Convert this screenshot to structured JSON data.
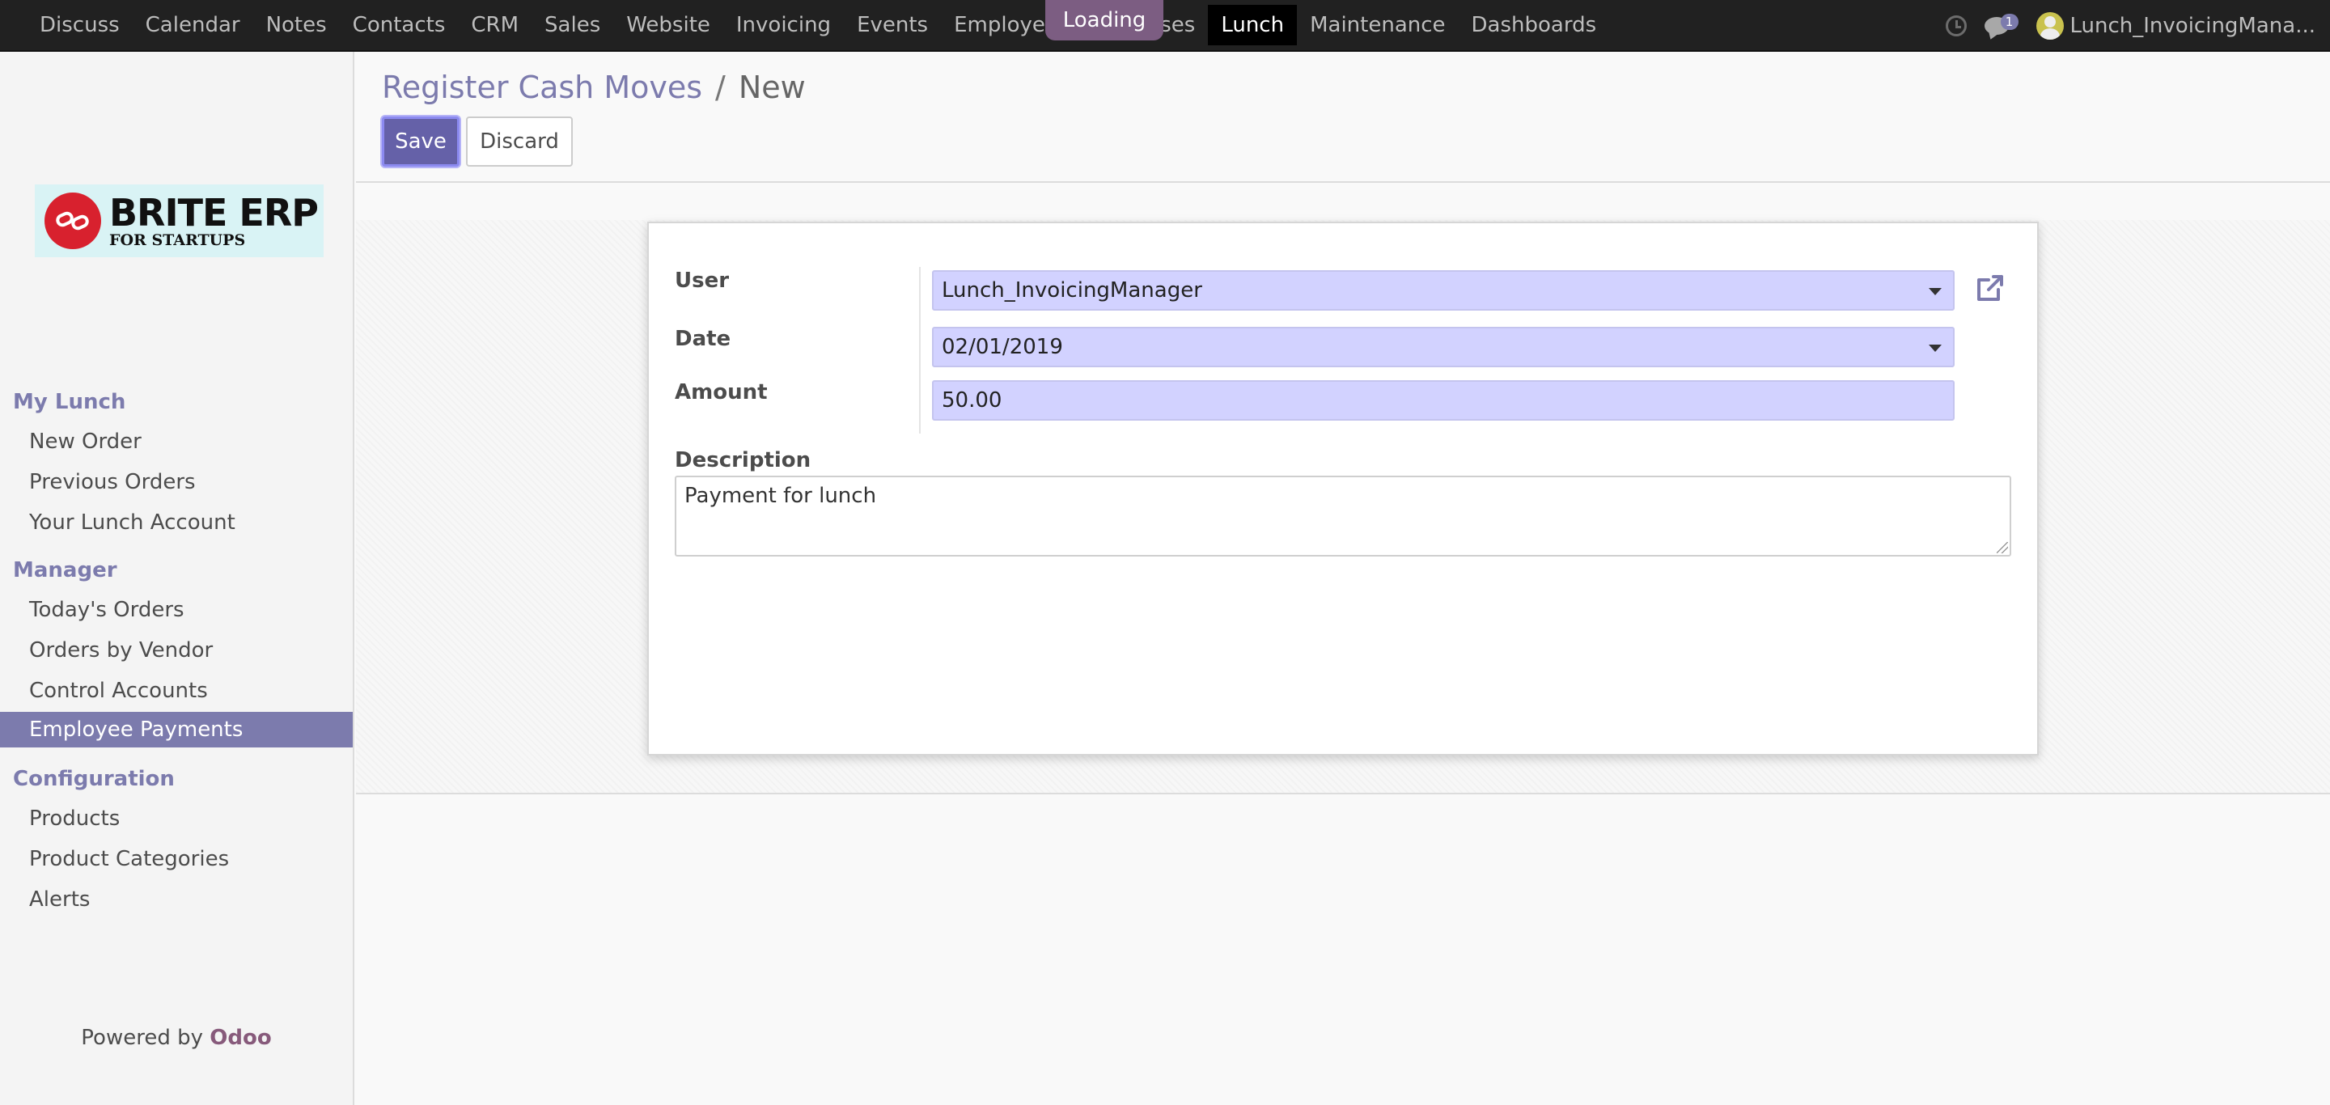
{
  "topnav": {
    "items": [
      "Discuss",
      "Calendar",
      "Notes",
      "Contacts",
      "CRM",
      "Sales",
      "Website",
      "Invoicing",
      "Events",
      "Employees",
      "Expenses",
      "Lunch",
      "Maintenance",
      "Dashboards"
    ],
    "loading_label": "Loading",
    "chat_badge": "1",
    "user_name": "Lunch_InvoicingMana..."
  },
  "logo": {
    "main": "BRITE ERP",
    "sub": "FOR STARTUPS"
  },
  "sidebar": {
    "sections": [
      "My Lunch",
      "Manager",
      "Configuration"
    ],
    "my_lunch": [
      "New Order",
      "Previous Orders",
      "Your Lunch Account"
    ],
    "manager": [
      "Today's Orders",
      "Orders by Vendor",
      "Control Accounts",
      "Employee Payments"
    ],
    "configuration": [
      "Products",
      "Product Categories",
      "Alerts"
    ],
    "powered_prefix": "Powered by",
    "powered_brand": "Odoo"
  },
  "breadcrumb": {
    "parent": "Register Cash Moves",
    "separator": "/",
    "current": "New"
  },
  "buttons": {
    "save": "Save",
    "discard": "Discard"
  },
  "form": {
    "user_label": "User",
    "user_value": "Lunch_InvoicingManager",
    "date_label": "Date",
    "date_value": "02/01/2019",
    "amount_label": "Amount",
    "amount_value": "50.00",
    "description_label": "Description",
    "description_value": "Payment for lunch"
  },
  "colors": {
    "accent": "#7c7bad",
    "save_button": "#6561a8",
    "input_required_bg": "#d2d2ff",
    "navbar_bg": "#212121",
    "odoo_brand": "#875a7b"
  },
  "icons": {
    "clock": "clock-icon",
    "chat": "chat-icon",
    "external_link": "external-link-icon",
    "dropdown": "caret-down-icon"
  }
}
